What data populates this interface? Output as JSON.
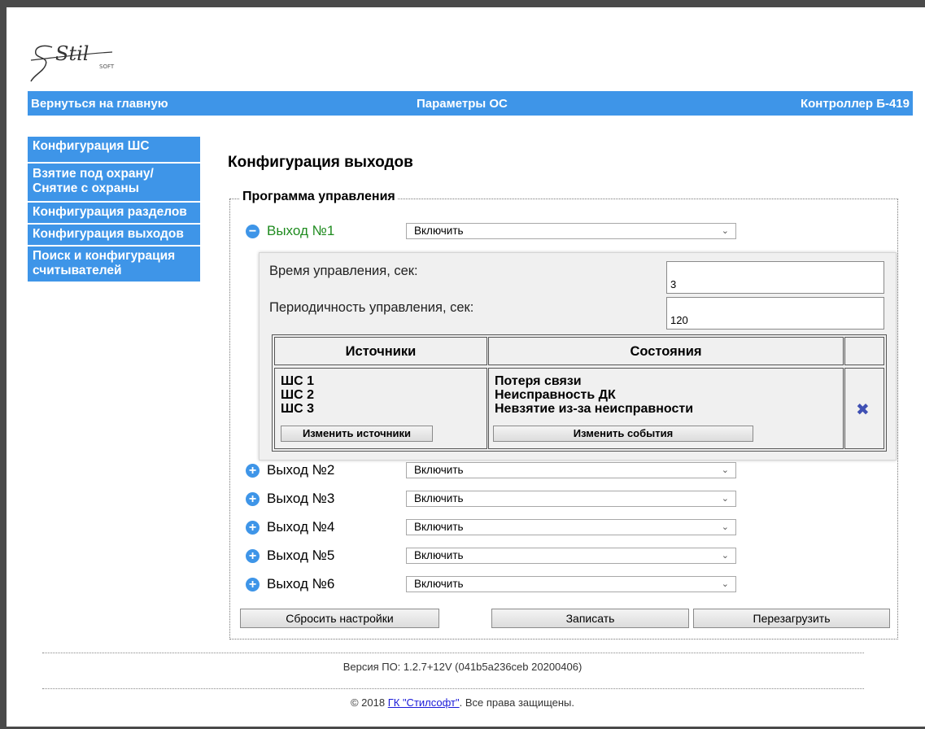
{
  "brand": {
    "logo_text": "Stil",
    "logo_sub": "SOFT"
  },
  "topbar": {
    "home_link": "Вернуться на главную",
    "section_title": "Параметры ОС",
    "device_title": "Контроллер Б-419"
  },
  "sidebar": {
    "items": [
      {
        "label": "Конфигурация ШС"
      },
      {
        "label": "Взятие под охрану/ Снятие с охраны"
      },
      {
        "label": "Конфигурация разделов"
      },
      {
        "label": "Конфигурация выходов"
      },
      {
        "label": "Поиск и конфигурация считывателей"
      }
    ]
  },
  "main": {
    "title": "Конфигурация выходов",
    "group_legend": "Программа управления",
    "outputs": [
      {
        "label": "Выход №1",
        "mode": "Включить",
        "expanded": true
      },
      {
        "label": "Выход №2",
        "mode": "Включить",
        "expanded": false
      },
      {
        "label": "Выход №3",
        "mode": "Включить",
        "expanded": false
      },
      {
        "label": "Выход №4",
        "mode": "Включить",
        "expanded": false
      },
      {
        "label": "Выход №5",
        "mode": "Включить",
        "expanded": false
      },
      {
        "label": "Выход №6",
        "mode": "Включить",
        "expanded": false
      }
    ],
    "detail": {
      "control_time_label": "Время управления, сек:",
      "control_time_value": "3",
      "period_label": "Периодичность управления, сек:",
      "period_value": "120",
      "table": {
        "headers": [
          "Источники",
          "Состояния",
          ""
        ],
        "sources": [
          "ШС 1",
          "ШС 2",
          "ШС 3"
        ],
        "states": [
          "Потеря связи",
          "Неисправность ДК",
          "Невзятие из-за неисправности"
        ],
        "change_sources_label": "Изменить источники",
        "change_events_label": "Изменить события"
      }
    },
    "buttons": {
      "reset": "Сбросить настройки",
      "save": "Записать",
      "reboot": "Перезагрузить"
    }
  },
  "footer": {
    "version": "Версия ПО: 1.2.7+12V (041b5a236ceb 20200406)",
    "copyright_prefix": "© 2018 ",
    "company_link": "ГК \"Стилсофт\"",
    "copyright_suffix": ". Все права защищены."
  },
  "colors": {
    "accent": "#3e95e8",
    "expanded_label": "#1f8b1f",
    "delete_icon": "#3f50b3"
  }
}
